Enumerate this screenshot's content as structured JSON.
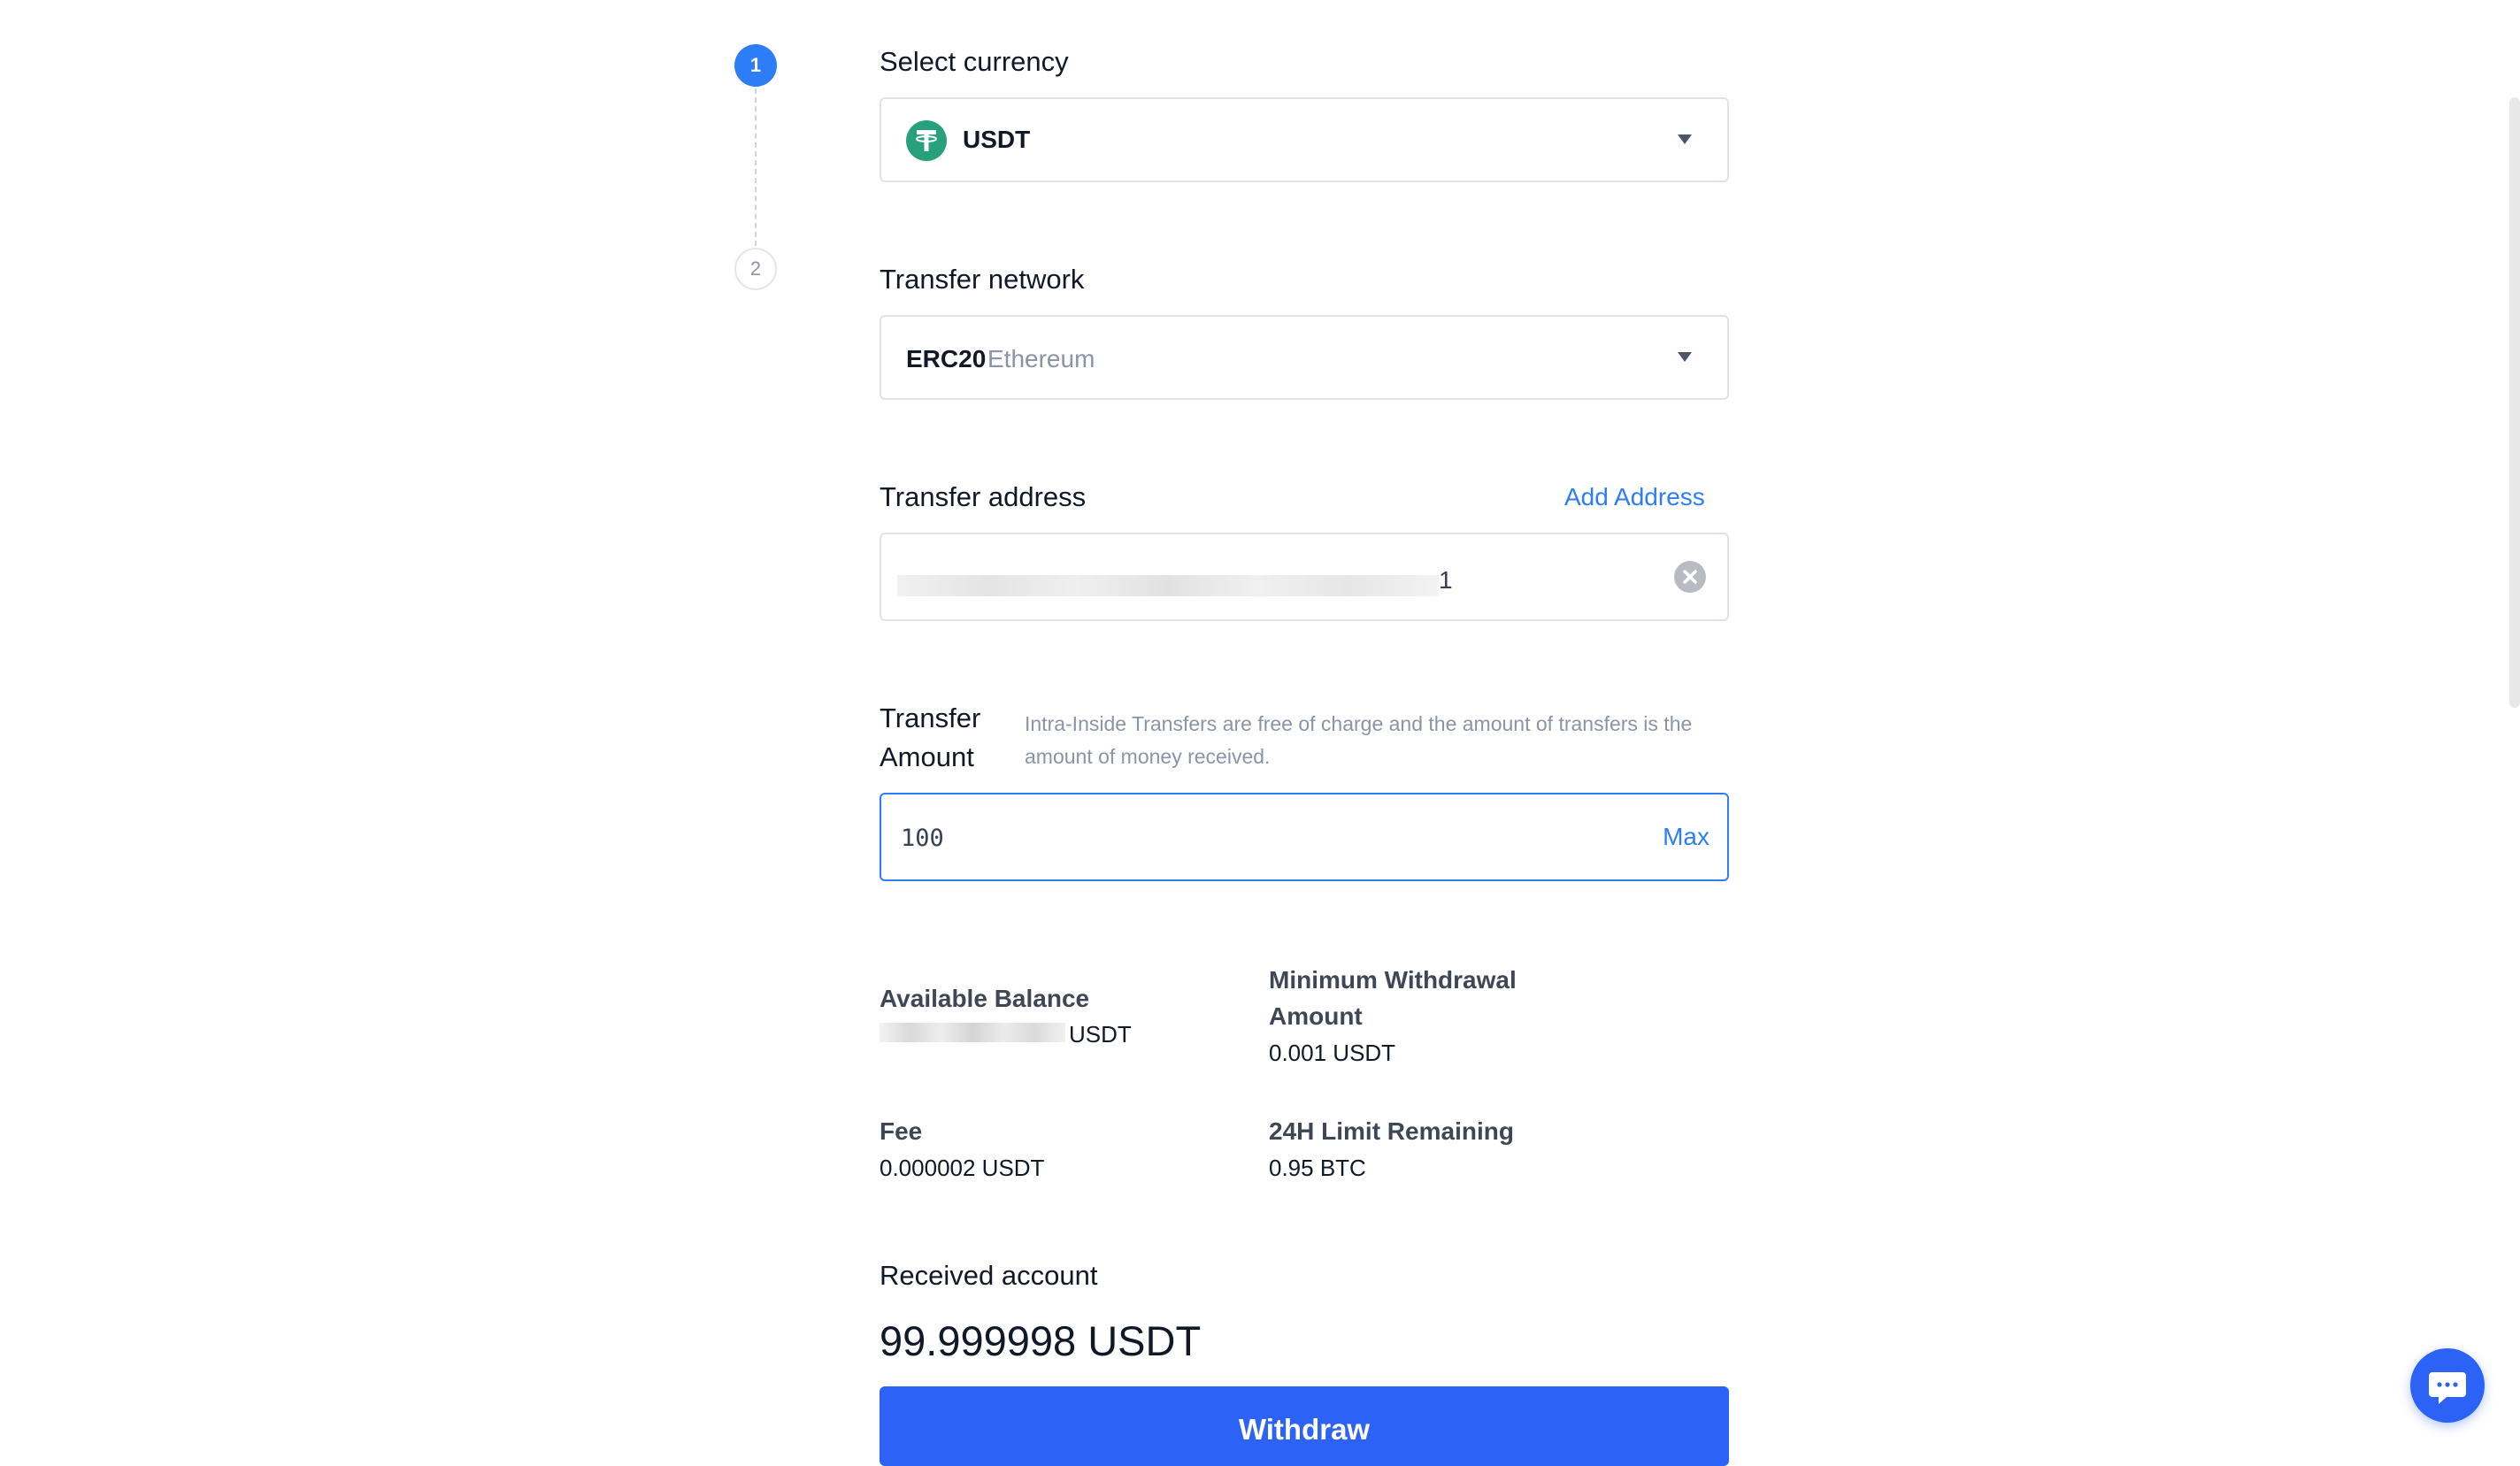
{
  "stepper": {
    "step1": "1",
    "step2": "2"
  },
  "currency": {
    "label": "Select currency",
    "value": "USDT",
    "icon": "tether-icon"
  },
  "network": {
    "label": "Transfer network",
    "code": "ERC20",
    "name": "Ethereum"
  },
  "address": {
    "label": "Transfer address",
    "add_link": "Add Address",
    "value_tail": "1"
  },
  "amount": {
    "label_line1": "Transfer",
    "label_line2": "Amount",
    "hint": "Intra-Inside Transfers are free of charge and the amount of transfers is the amount of money received.",
    "value": "100",
    "max_label": "Max"
  },
  "info": {
    "available_label": "Available Balance",
    "available_unit": "USDT",
    "min_label_line1": "Minimum Withdrawal",
    "min_label_line2": "Amount",
    "min_value": "0.001 USDT",
    "fee_label": "Fee",
    "fee_value": "0.000002 USDT",
    "limit_label": "24H Limit Remaining",
    "limit_value": "0.95 BTC"
  },
  "received": {
    "label": "Received account",
    "value": "99.999998 USDT"
  },
  "withdraw_button": "Withdraw",
  "colors": {
    "accent": "#2d7ef6",
    "button": "#2d62f6",
    "tether": "#26a17b"
  }
}
